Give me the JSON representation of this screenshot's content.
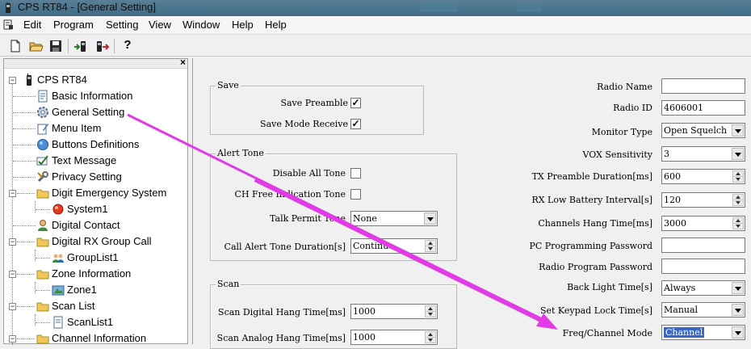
{
  "window": {
    "title": "CPS RT84 - [General Setting]"
  },
  "menu": [
    "Edit",
    "Program",
    "Setting",
    "View",
    "Window",
    "Help",
    "Help"
  ],
  "toolbar": {
    "help_glyph": "?"
  },
  "tree": {
    "close_glyph": "×",
    "root": "CPS RT84",
    "items": [
      "Basic Information",
      "General Setting",
      "Menu Item",
      "Buttons Definitions",
      "Text Message",
      "Privacy Setting",
      "Digit Emergency System",
      "System1",
      "Digital Contact",
      "Digital RX Group Call",
      "GroupList1",
      "Zone Information",
      "Zone1",
      "Scan List",
      "ScanList1",
      "Channel Information"
    ]
  },
  "save_group": {
    "title": "Save",
    "preamble_label": "Save Preamble",
    "preamble_checked": "✓",
    "mode_receive_label": "Save Mode Receive",
    "mode_receive_checked": "✓"
  },
  "alert_group": {
    "title": "Alert Tone",
    "disable_all_label": "Disable All Tone",
    "ch_free_label": "CH Free Indication Tone",
    "talk_permit_label": "Talk Permit Tone",
    "talk_permit_value": "None",
    "call_alert_label": "Call Alert Tone Duration[s]",
    "call_alert_value": "Continue"
  },
  "scan_group": {
    "title": "Scan",
    "digital_hang_label": "Scan Digital Hang Time[ms]",
    "digital_hang_value": "1000",
    "analog_hang_label": "Scan Analog Hang Time[ms]",
    "analog_hang_value": "1000"
  },
  "right": {
    "radio_name_label": "Radio Name",
    "radio_name_value": "",
    "radio_id_label": "Radio ID",
    "radio_id_value": "4606001",
    "monitor_type_label": "Monitor Type",
    "monitor_type_value": "Open Squelch",
    "vox_label": "VOX Sensitivity",
    "vox_value": "3",
    "tx_preamble_label": "TX Preamble Duration[ms]",
    "tx_preamble_value": "600",
    "rx_low_batt_label": "RX Low Battery Interval[s]",
    "rx_low_batt_value": "120",
    "ch_hang_label": "Channels Hang Time[ms]",
    "ch_hang_value": "3000",
    "pc_pwd_label": "PC Programming Password",
    "pc_pwd_value": "",
    "radio_pwd_label": "Radio Program Password",
    "radio_pwd_value": "",
    "backlight_label": "Back Light Time[s]",
    "backlight_value": "Always",
    "keypad_lock_label": "Set Keypad Lock Time[s]",
    "keypad_lock_value": "Manual",
    "freq_mode_label": "Freq/Channel Mode",
    "freq_mode_value": "Channel"
  },
  "colors": {
    "arrow": "#e13be6",
    "selection": "#3a67c6"
  }
}
